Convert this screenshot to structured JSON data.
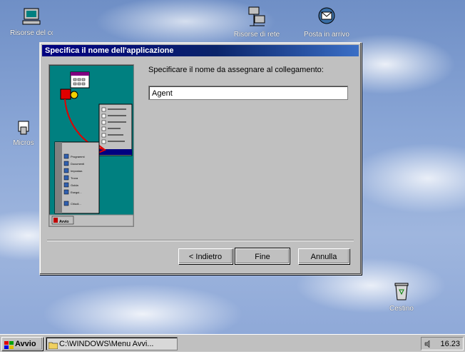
{
  "desktop": {
    "icons": [
      {
        "label": "Risorse del computer",
        "icon": "my-computer-icon"
      },
      {
        "label": "Micros",
        "icon": "msn-icon"
      },
      {
        "label": "Risorse di rete",
        "icon": "network-icon"
      },
      {
        "label": "Posta in arrivo",
        "icon": "inbox-icon"
      },
      {
        "label": "Cestino",
        "icon": "recycle-bin-icon"
      }
    ]
  },
  "dialog": {
    "title": "Specifica il nome dell'applicazione",
    "prompt": "Specificare il nome da assegnare al collegamento:",
    "name_value": "Agent",
    "buttons": {
      "back": "< Indietro",
      "finish": "Fine",
      "cancel": "Annulla"
    },
    "illustration": {
      "menu_items": [
        "Programmi",
        "Documenti",
        "Impostazioni",
        "Trova",
        "Guida",
        "Esegui...",
        "Chiudi sessione..."
      ],
      "start_label": "Avvio"
    }
  },
  "taskbar": {
    "start_label": "Avvio",
    "task_label": "C:\\WINDOWS\\Menu Avvi...",
    "clock": "16.23"
  },
  "colors": {
    "title_bar": "#000080",
    "dialog_face": "#c0c0c0",
    "illustration_bg": "#008080"
  }
}
